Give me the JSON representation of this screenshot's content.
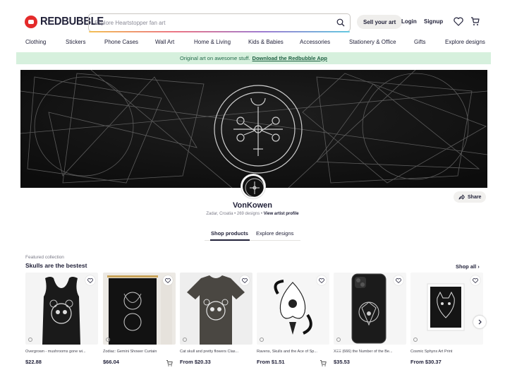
{
  "header": {
    "logo_text": "REDBUBBLE",
    "search_placeholder": "Explore Heartstopper fan art",
    "sell_label": "Sell your art",
    "login_label": "Login",
    "signup_label": "Signup"
  },
  "nav": {
    "items": [
      "Clothing",
      "Stickers",
      "Phone Cases",
      "Wall Art",
      "Home & Living",
      "Kids & Babies",
      "Accessories",
      "Stationery & Office",
      "Gifts",
      "Explore designs"
    ]
  },
  "promo": {
    "text": "Original art on awesome stuff.",
    "link": "Download the Redbubble App"
  },
  "profile": {
    "name": "VonKowen",
    "location": "Zadar, Croatia",
    "designs": "269 designs",
    "view_profile": "View artist profile",
    "share_label": "Share"
  },
  "tabs": {
    "shop": "Shop products",
    "explore": "Explore designs"
  },
  "collection": {
    "label": "Featured collection",
    "title": "Skulls are the bestest",
    "shop_all": "Shop all"
  },
  "products": [
    {
      "title": "Overgrown - mushrooms gone wi...",
      "price": "$22.88"
    },
    {
      "title": "Zodiac: Gemini Shower Curtain",
      "price": "$66.04"
    },
    {
      "title": "Cat skull and pretty flowers Clas...",
      "price": "From $20.33"
    },
    {
      "title": "Ravens, Skulls and the Ace of Sp...",
      "price": "From $1.51"
    },
    {
      "title": "XΞΞ (666) the Number of the Be...",
      "price": "$35.53"
    },
    {
      "title": "Cosmic Sphynx Art Print",
      "price": "From $30.37"
    }
  ],
  "colors": {
    "brand_red": "#e42b2b",
    "promo_bg": "#d6f0dd",
    "text_dark": "#22223a"
  }
}
